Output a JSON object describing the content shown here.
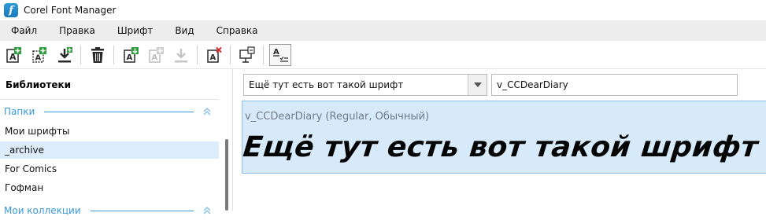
{
  "app": {
    "title": "Corel Font Manager",
    "icon_letter": "f"
  },
  "menu": [
    {
      "label": "Файл"
    },
    {
      "label": "Правка"
    },
    {
      "label": "Шрифт"
    },
    {
      "label": "Вид"
    },
    {
      "label": "Справка"
    }
  ],
  "toolbar": {
    "buttons": [
      {
        "icon": "add-font-icon",
        "enabled": true
      },
      {
        "icon": "add-font-folder-icon",
        "enabled": true
      },
      {
        "icon": "download-icon",
        "enabled": true
      },
      {
        "icon": "trash-icon",
        "enabled": true
      },
      {
        "icon": "install-font-icon",
        "enabled": true
      },
      {
        "icon": "add-font-disabled-icon",
        "enabled": false
      },
      {
        "icon": "download-disabled-icon",
        "enabled": false
      },
      {
        "icon": "uninstall-font-icon",
        "enabled": true
      },
      {
        "icon": "font-details-icon",
        "enabled": true
      },
      {
        "icon": "text-list-icon",
        "enabled": true
      }
    ],
    "colors": {
      "green": "#2e9e3c",
      "red": "#d83030",
      "dark": "#2a2a2a",
      "disabled": "#bdbdbd"
    }
  },
  "libraries": {
    "title": "Библиотеки",
    "section_label": "Папки",
    "items": [
      {
        "label": "Мои шрифты",
        "selected": false
      },
      {
        "label": "_archive",
        "selected": true
      },
      {
        "label": "For Comics",
        "selected": false
      },
      {
        "label": "Гофман",
        "selected": false
      }
    ],
    "next_section_label": "Мои коллекции"
  },
  "preview": {
    "sample_text": "Ещё тут есть вот такой шрифт",
    "font_filter_value": "v_CCDearDiary",
    "font_name": "v_CCDearDiary (Regular, Обычный)",
    "sample_rendered": "Ещё тут есть вот такой шрифт"
  },
  "colors": {
    "accent": "#3a9ad9",
    "selection": "#dcecfa",
    "preview_bg": "#d6eaf9",
    "menubar_bg": "#ededed"
  }
}
